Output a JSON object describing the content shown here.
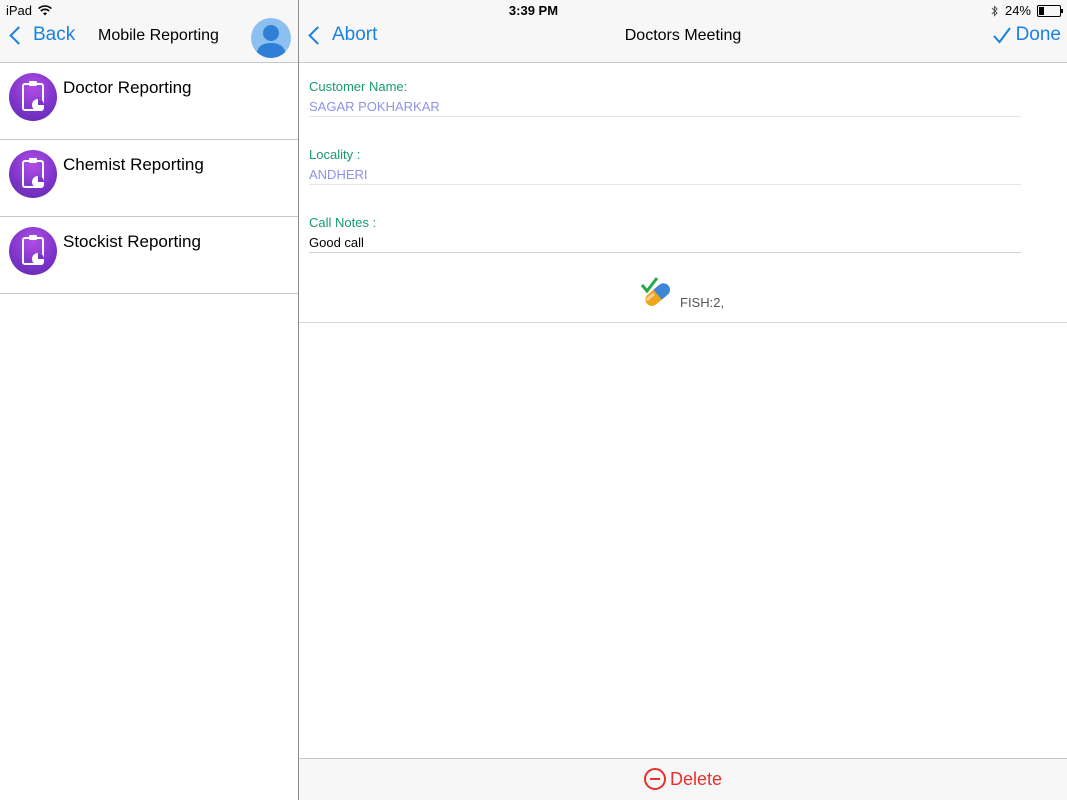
{
  "status_bar": {
    "device": "iPad",
    "time": "3:39 PM",
    "battery_percent": "24%",
    "battery_level": 0.24
  },
  "master": {
    "back_label": "Back",
    "title": "Mobile Reporting",
    "items": [
      {
        "label": "Doctor Reporting",
        "icon": "clipboard-chart-icon"
      },
      {
        "label": "Chemist Reporting",
        "icon": "clipboard-chart-icon"
      },
      {
        "label": "Stockist Reporting",
        "icon": "clipboard-chart-icon"
      }
    ]
  },
  "detail": {
    "abort_label": "Abort",
    "title": "Doctors Meeting",
    "done_label": "Done",
    "fields": {
      "customer_name_label": "Customer Name:",
      "customer_name_value": "SAGAR POKHARKAR",
      "locality_label": "Locality :",
      "locality_value": "ANDHERI",
      "call_notes_label": "Call Notes :",
      "call_notes_value": "Good call"
    },
    "product": {
      "icon": "pill-check-icon",
      "text": "FISH:2,"
    },
    "delete_label": "Delete"
  },
  "colors": {
    "accent": "#1a82e2",
    "label_green": "#149b6f",
    "readonly_value": "#8f92e6",
    "delete_red": "#e8302a",
    "icon_purple": "#7a33c9"
  }
}
